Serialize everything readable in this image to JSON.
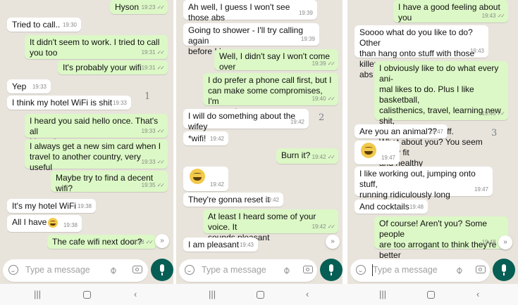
{
  "screen1": {
    "messages": [
      {
        "text": "Hyson",
        "time": "19:23",
        "ticks": "✓✓"
      },
      {
        "text": "Tried to call..",
        "time": "19:30",
        "ticks": ""
      },
      {
        "text": "It didn't seem to work. I tried to call\nyou too",
        "time": "19:31",
        "ticks": "✓✓"
      },
      {
        "text": "It's probably your wifi",
        "time": "19:31",
        "ticks": "✓✓"
      },
      {
        "text": "Yep",
        "time": "19:33",
        "ticks": ""
      },
      {
        "text": "I think my hotel WiFi is shit",
        "time": "19:33",
        "ticks": ""
      },
      {
        "text": "I heard you said hello once. That's all\nI heard",
        "time": "19:33",
        "ticks": "✓✓"
      },
      {
        "text": "I always get a new sim card when I\ntravel to another country, very useful",
        "time": "19:33",
        "ticks": "✓✓"
      },
      {
        "text": "Maybe try to find a decent wifi?",
        "time": "19:35",
        "ticks": "✓✓"
      },
      {
        "text": "It's my hotel WiFi",
        "time": "19:38",
        "ticks": ""
      },
      {
        "text": "All I have",
        "time": "19:38",
        "ticks": ""
      },
      {
        "text": "The cafe wifi next door?",
        "time": "19:38",
        "ticks": "✓✓"
      }
    ],
    "annotation": "1",
    "composer_placeholder": "Type a message"
  },
  "screen2": {
    "messages": [
      {
        "text": "Ah well, I guess I won't see those abs",
        "time": "19:39",
        "ticks": ""
      },
      {
        "text": "Going to shower - I'll try calling again\nbefore I leave",
        "time": "19:39",
        "ticks": ""
      },
      {
        "text": "Well, I didn't say I won't come over",
        "time": "19:39",
        "ticks": "✓✓"
      },
      {
        "text": "I do prefer a phone call first, but I\ncan make some compromises, I'm\neasygoing",
        "time": "19:40",
        "ticks": "✓✓"
      },
      {
        "text": "I will do something about the wifey",
        "time": "19:42",
        "ticks": ""
      },
      {
        "text": "*wifi!",
        "time": "19:42",
        "ticks": ""
      },
      {
        "text": "Burn it?",
        "time": "19:42",
        "ticks": "✓✓"
      },
      {
        "text": "",
        "time": "19:42",
        "ticks": ""
      },
      {
        "text": "They're gonna reset it",
        "time": "19:42",
        "ticks": ""
      },
      {
        "text": "At least I heard some of your voice. It\nsounds pleasant",
        "time": "19:42",
        "ticks": "✓✓"
      },
      {
        "text": "I am pleasant",
        "time": "19:43",
        "ticks": ""
      }
    ],
    "annotation": "2",
    "composer_placeholder": "Type a message"
  },
  "screen3": {
    "messages": [
      {
        "text": "I have a good feeling about you",
        "time": "19:43",
        "ticks": "✓✓"
      },
      {
        "text": "Soooo what do you like to do? Other\nthan hang onto stuff with those killer\nabs",
        "time": "19:43",
        "ticks": ""
      },
      {
        "text": "I obviously like to do what every ani-\nmal likes to do. Plus I like basketball,\ncalisthenics, travel, learning new shit,\nbeing free and stuff.\nWhat about you? You seem pretty fit\nand healthy",
        "time": "19:45",
        "ticks": "✓✓"
      },
      {
        "text": "Are you an animal??",
        "time": "19:47",
        "ticks": ""
      },
      {
        "text": "",
        "time": "19:47",
        "ticks": ""
      },
      {
        "text": "I like working out, jumping onto stuff,\nrunning ridiculously long distances",
        "time": "19:47",
        "ticks": ""
      },
      {
        "text": "And cocktails",
        "time": "19:48",
        "ticks": ""
      },
      {
        "text": "Of course! Aren't you? Some people\nare too arrogant to think they're better\nthan animals",
        "time": "19:48",
        "ticks": "✓✓"
      }
    ],
    "annotation": "3",
    "composer_placeholder": "Type a message"
  },
  "icons": {
    "emoji": "smiley-icon",
    "attach": "paperclip-icon",
    "camera": "camera-icon",
    "mic": "microphone-icon",
    "scroll": "chevron-double-down-icon",
    "nav_recents": "recents-icon",
    "nav_home": "home-icon",
    "nav_back": "back-icon"
  },
  "colors": {
    "outgoing_bubble": "#dcf8c6",
    "incoming_bubble": "#ffffff",
    "chat_background": "#e8e4dc",
    "mic_button": "#075e54"
  }
}
